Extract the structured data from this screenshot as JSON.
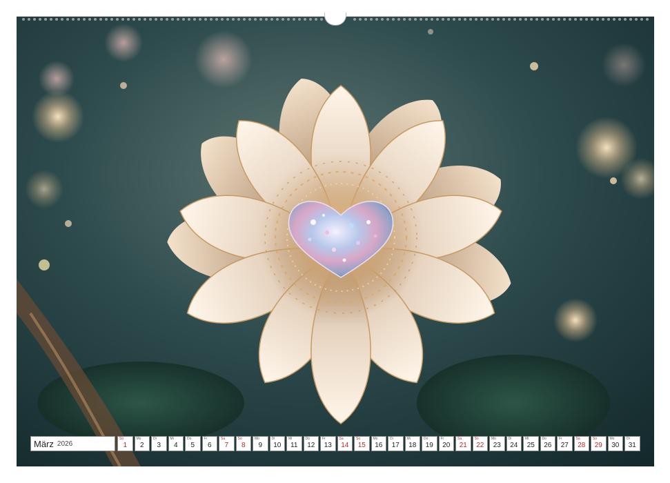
{
  "calendar": {
    "month": "März",
    "year": "2026",
    "days": [
      {
        "abbr": "So",
        "num": "1",
        "weekend": true
      },
      {
        "abbr": "Mo",
        "num": "2",
        "weekend": false
      },
      {
        "abbr": "Di",
        "num": "3",
        "weekend": false
      },
      {
        "abbr": "Mi",
        "num": "4",
        "weekend": false
      },
      {
        "abbr": "Do",
        "num": "5",
        "weekend": false
      },
      {
        "abbr": "Fr",
        "num": "6",
        "weekend": false
      },
      {
        "abbr": "Sa",
        "num": "7",
        "weekend": true
      },
      {
        "abbr": "So",
        "num": "8",
        "weekend": true
      },
      {
        "abbr": "Mo",
        "num": "9",
        "weekend": false
      },
      {
        "abbr": "Di",
        "num": "10",
        "weekend": false
      },
      {
        "abbr": "Mi",
        "num": "11",
        "weekend": false
      },
      {
        "abbr": "Do",
        "num": "12",
        "weekend": false
      },
      {
        "abbr": "Fr",
        "num": "13",
        "weekend": false
      },
      {
        "abbr": "Sa",
        "num": "14",
        "weekend": true
      },
      {
        "abbr": "So",
        "num": "15",
        "weekend": true
      },
      {
        "abbr": "Mo",
        "num": "16",
        "weekend": false
      },
      {
        "abbr": "Di",
        "num": "17",
        "weekend": false
      },
      {
        "abbr": "Mi",
        "num": "18",
        "weekend": false
      },
      {
        "abbr": "Do",
        "num": "19",
        "weekend": false
      },
      {
        "abbr": "Fr",
        "num": "20",
        "weekend": false
      },
      {
        "abbr": "Sa",
        "num": "21",
        "weekend": true
      },
      {
        "abbr": "So",
        "num": "22",
        "weekend": true
      },
      {
        "abbr": "Mo",
        "num": "23",
        "weekend": false
      },
      {
        "abbr": "Di",
        "num": "24",
        "weekend": false
      },
      {
        "abbr": "Mi",
        "num": "25",
        "weekend": false
      },
      {
        "abbr": "Do",
        "num": "26",
        "weekend": false
      },
      {
        "abbr": "Fr",
        "num": "27",
        "weekend": false
      },
      {
        "abbr": "Sa",
        "num": "28",
        "weekend": true
      },
      {
        "abbr": "So",
        "num": "29",
        "weekend": true
      },
      {
        "abbr": "Mo",
        "num": "30",
        "weekend": false
      },
      {
        "abbr": "Di",
        "num": "31",
        "weekend": false
      }
    ]
  },
  "colors": {
    "background_teal": "#1c3638",
    "petal_cream": "#f3e6d6",
    "petal_gold": "#c89a62",
    "weekend_red": "#c0282b"
  },
  "photo": {
    "subject": "flower-with-glitter-heart-illustration"
  }
}
